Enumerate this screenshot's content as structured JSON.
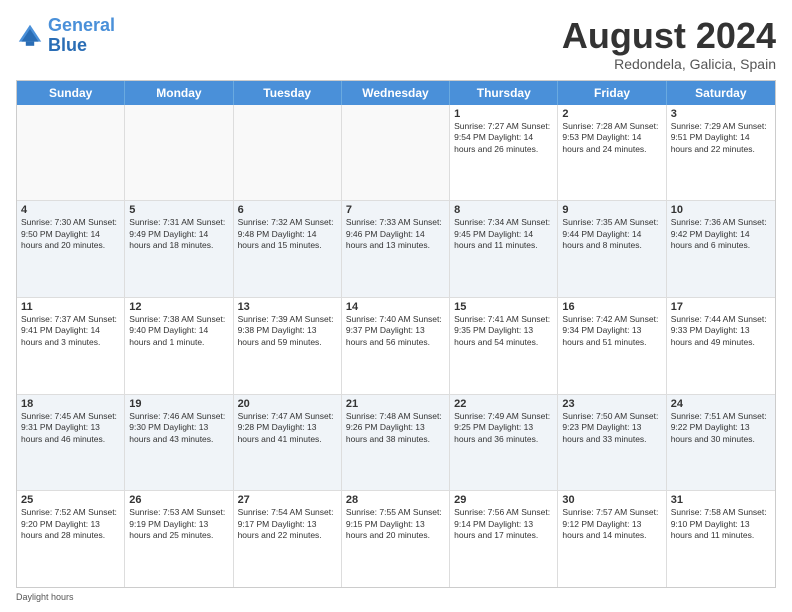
{
  "logo": {
    "line1": "General",
    "line2": "Blue"
  },
  "title": "August 2024",
  "subtitle": "Redondela, Galicia, Spain",
  "days_of_week": [
    "Sunday",
    "Monday",
    "Tuesday",
    "Wednesday",
    "Thursday",
    "Friday",
    "Saturday"
  ],
  "weeks": [
    [
      {
        "day": "",
        "info": ""
      },
      {
        "day": "",
        "info": ""
      },
      {
        "day": "",
        "info": ""
      },
      {
        "day": "",
        "info": ""
      },
      {
        "day": "1",
        "info": "Sunrise: 7:27 AM\nSunset: 9:54 PM\nDaylight: 14 hours and 26 minutes."
      },
      {
        "day": "2",
        "info": "Sunrise: 7:28 AM\nSunset: 9:53 PM\nDaylight: 14 hours and 24 minutes."
      },
      {
        "day": "3",
        "info": "Sunrise: 7:29 AM\nSunset: 9:51 PM\nDaylight: 14 hours and 22 minutes."
      }
    ],
    [
      {
        "day": "4",
        "info": "Sunrise: 7:30 AM\nSunset: 9:50 PM\nDaylight: 14 hours and 20 minutes."
      },
      {
        "day": "5",
        "info": "Sunrise: 7:31 AM\nSunset: 9:49 PM\nDaylight: 14 hours and 18 minutes."
      },
      {
        "day": "6",
        "info": "Sunrise: 7:32 AM\nSunset: 9:48 PM\nDaylight: 14 hours and 15 minutes."
      },
      {
        "day": "7",
        "info": "Sunrise: 7:33 AM\nSunset: 9:46 PM\nDaylight: 14 hours and 13 minutes."
      },
      {
        "day": "8",
        "info": "Sunrise: 7:34 AM\nSunset: 9:45 PM\nDaylight: 14 hours and 11 minutes."
      },
      {
        "day": "9",
        "info": "Sunrise: 7:35 AM\nSunset: 9:44 PM\nDaylight: 14 hours and 8 minutes."
      },
      {
        "day": "10",
        "info": "Sunrise: 7:36 AM\nSunset: 9:42 PM\nDaylight: 14 hours and 6 minutes."
      }
    ],
    [
      {
        "day": "11",
        "info": "Sunrise: 7:37 AM\nSunset: 9:41 PM\nDaylight: 14 hours and 3 minutes."
      },
      {
        "day": "12",
        "info": "Sunrise: 7:38 AM\nSunset: 9:40 PM\nDaylight: 14 hours and 1 minute."
      },
      {
        "day": "13",
        "info": "Sunrise: 7:39 AM\nSunset: 9:38 PM\nDaylight: 13 hours and 59 minutes."
      },
      {
        "day": "14",
        "info": "Sunrise: 7:40 AM\nSunset: 9:37 PM\nDaylight: 13 hours and 56 minutes."
      },
      {
        "day": "15",
        "info": "Sunrise: 7:41 AM\nSunset: 9:35 PM\nDaylight: 13 hours and 54 minutes."
      },
      {
        "day": "16",
        "info": "Sunrise: 7:42 AM\nSunset: 9:34 PM\nDaylight: 13 hours and 51 minutes."
      },
      {
        "day": "17",
        "info": "Sunrise: 7:44 AM\nSunset: 9:33 PM\nDaylight: 13 hours and 49 minutes."
      }
    ],
    [
      {
        "day": "18",
        "info": "Sunrise: 7:45 AM\nSunset: 9:31 PM\nDaylight: 13 hours and 46 minutes."
      },
      {
        "day": "19",
        "info": "Sunrise: 7:46 AM\nSunset: 9:30 PM\nDaylight: 13 hours and 43 minutes."
      },
      {
        "day": "20",
        "info": "Sunrise: 7:47 AM\nSunset: 9:28 PM\nDaylight: 13 hours and 41 minutes."
      },
      {
        "day": "21",
        "info": "Sunrise: 7:48 AM\nSunset: 9:26 PM\nDaylight: 13 hours and 38 minutes."
      },
      {
        "day": "22",
        "info": "Sunrise: 7:49 AM\nSunset: 9:25 PM\nDaylight: 13 hours and 36 minutes."
      },
      {
        "day": "23",
        "info": "Sunrise: 7:50 AM\nSunset: 9:23 PM\nDaylight: 13 hours and 33 minutes."
      },
      {
        "day": "24",
        "info": "Sunrise: 7:51 AM\nSunset: 9:22 PM\nDaylight: 13 hours and 30 minutes."
      }
    ],
    [
      {
        "day": "25",
        "info": "Sunrise: 7:52 AM\nSunset: 9:20 PM\nDaylight: 13 hours and 28 minutes."
      },
      {
        "day": "26",
        "info": "Sunrise: 7:53 AM\nSunset: 9:19 PM\nDaylight: 13 hours and 25 minutes."
      },
      {
        "day": "27",
        "info": "Sunrise: 7:54 AM\nSunset: 9:17 PM\nDaylight: 13 hours and 22 minutes."
      },
      {
        "day": "28",
        "info": "Sunrise: 7:55 AM\nSunset: 9:15 PM\nDaylight: 13 hours and 20 minutes."
      },
      {
        "day": "29",
        "info": "Sunrise: 7:56 AM\nSunset: 9:14 PM\nDaylight: 13 hours and 17 minutes."
      },
      {
        "day": "30",
        "info": "Sunrise: 7:57 AM\nSunset: 9:12 PM\nDaylight: 13 hours and 14 minutes."
      },
      {
        "day": "31",
        "info": "Sunrise: 7:58 AM\nSunset: 9:10 PM\nDaylight: 13 hours and 11 minutes."
      }
    ]
  ],
  "footer": "Daylight hours"
}
